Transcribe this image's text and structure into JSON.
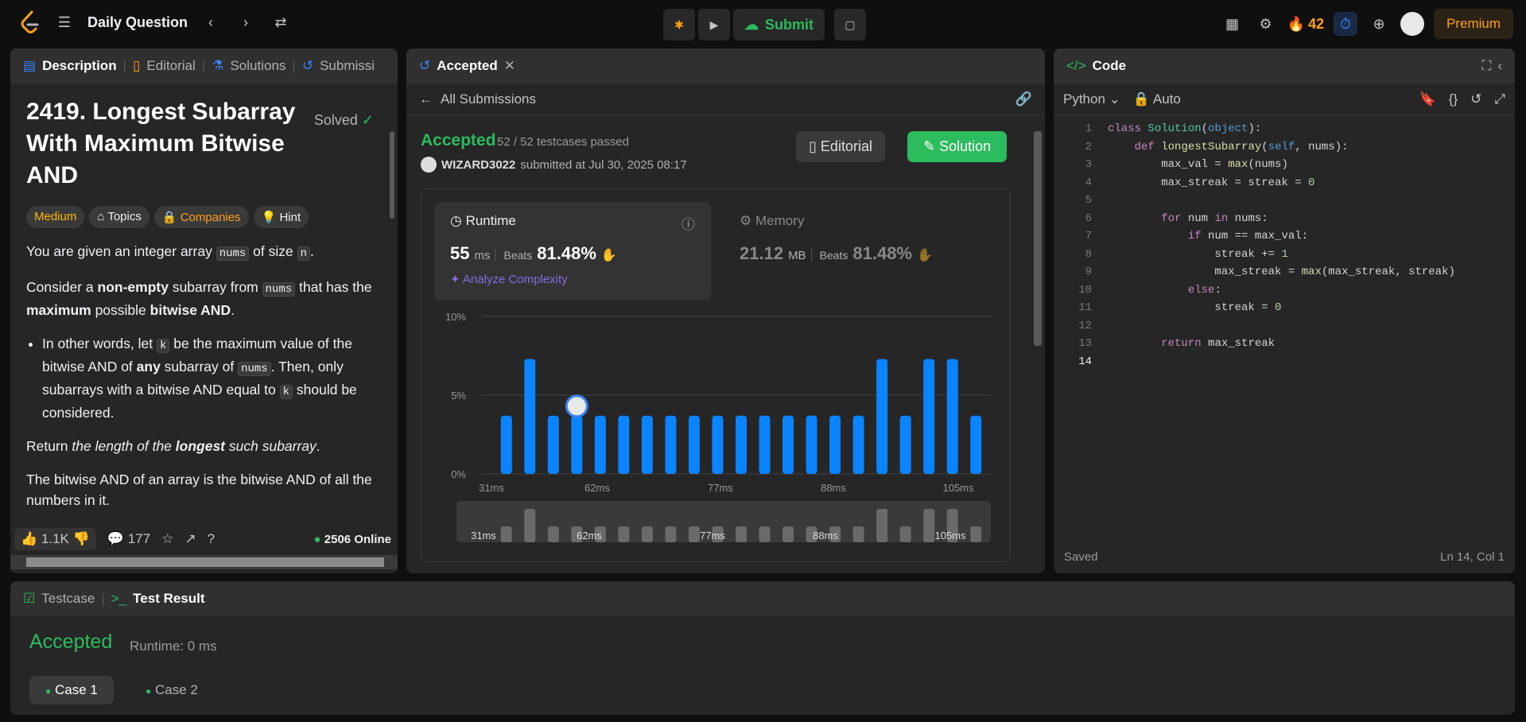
{
  "topbar": {
    "title": "Daily Question",
    "submit_label": "Submit",
    "streak": "42",
    "premium_label": "Premium"
  },
  "left": {
    "tabs": [
      "Description",
      "Editorial",
      "Solutions",
      "Submissi"
    ],
    "problem_title": "2419. Longest Subarray With Maximum Bitwise AND",
    "solved_label": "Solved",
    "tags": [
      "Medium",
      "Topics",
      "Companies",
      "Hint"
    ],
    "p1_a": "You are given an integer array ",
    "p1_code1": "nums",
    "p1_b": " of size ",
    "p1_code2": "n",
    "p1_c": ".",
    "p2_a": "Consider a ",
    "p2_b": "non-empty",
    "p2_c": " subarray from ",
    "p2_code": "nums",
    "p2_d": " that has the ",
    "p2_e": "maximum",
    "p2_f": " possible ",
    "p2_g": "bitwise AND",
    "p2_h": ".",
    "li_a": "In other words, let ",
    "li_code1": "k",
    "li_b": " be the maximum value of the bitwise AND of ",
    "li_c": "any",
    "li_d": " subarray of ",
    "li_code2": "nums",
    "li_e": ". Then, only subarrays with a bitwise AND equal to ",
    "li_code3": "k",
    "li_f": " should be considered.",
    "p3_a": "Return ",
    "p3_b": "the length of the ",
    "p3_c": "longest",
    "p3_d": " such subarray",
    "p3_e": ".",
    "p4": "The bitwise AND of an array is the bitwise AND of all the numbers in it.",
    "likes": "1.1K",
    "comments": "177",
    "online": "2506 Online"
  },
  "mid": {
    "tab": "Accepted",
    "all_submissions": "All Submissions",
    "status": "Accepted",
    "testcases": "52 / 52 testcases passed",
    "user": "WIZARD3022",
    "submitted_at": "submitted at Jul 30, 2025 08:17",
    "editorial_btn": "Editorial",
    "solution_btn": "Solution",
    "runtime_label": "Runtime",
    "runtime_val": "55",
    "runtime_unit": "ms",
    "beats_label": "Beats",
    "runtime_beats": "81.48%",
    "analyze": "Analyze Complexity",
    "memory_label": "Memory",
    "memory_val": "21.12",
    "memory_unit": "MB",
    "memory_beats": "81.48%"
  },
  "chart_data": {
    "type": "bar",
    "y_ticks": [
      "10%",
      "5%",
      "0%"
    ],
    "ylim": [
      0,
      10
    ],
    "x_ticks": [
      "31ms",
      "62ms",
      "77ms",
      "88ms",
      "105ms"
    ],
    "values": [
      3.7,
      7.3,
      3.7,
      3.7,
      3.7,
      3.7,
      3.7,
      3.7,
      3.7,
      3.7,
      3.7,
      3.7,
      3.7,
      3.7,
      3.7,
      3.7,
      7.3,
      3.7,
      7.3,
      7.3,
      3.7
    ],
    "highlight_index": 3,
    "bar_color": "#0a84ff"
  },
  "right": {
    "tab": "Code",
    "language": "Python",
    "mode": "Auto",
    "saved": "Saved",
    "cursor": "Ln 14, Col 1",
    "code": [
      "class Solution(object):",
      "    def longestSubarray(self, nums):",
      "        max_val = max(nums)",
      "        max_streak = streak = 0",
      "",
      "        for num in nums:",
      "            if num == max_val:",
      "                streak += 1",
      "                max_streak = max(max_streak, streak)",
      "            else:",
      "                streak = 0",
      "",
      "        return max_streak",
      ""
    ]
  },
  "bottom": {
    "tabs": [
      "Testcase",
      "Test Result"
    ],
    "status": "Accepted",
    "runtime": "Runtime: 0 ms",
    "cases": [
      "Case 1",
      "Case 2"
    ]
  }
}
